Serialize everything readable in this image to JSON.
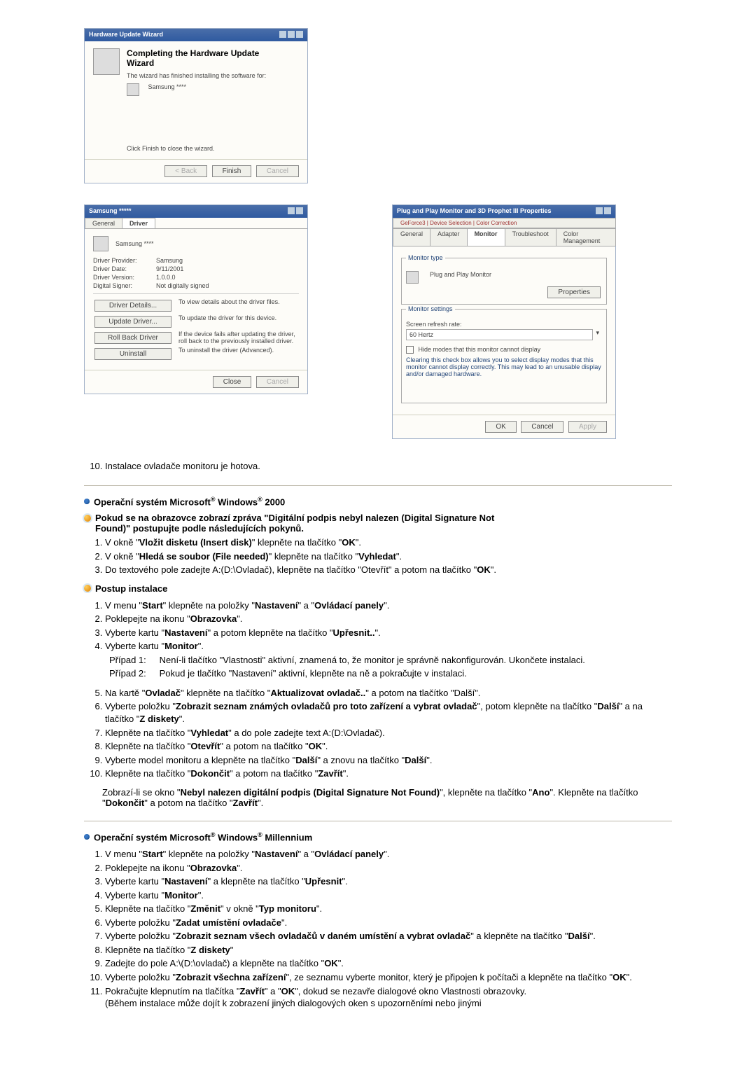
{
  "wizard": {
    "title": "Hardware Update Wizard",
    "heading": "Completing the Hardware Update Wizard",
    "line1": "The wizard has finished installing the software for:",
    "device": "Samsung ****",
    "line2": "Click Finish to close the wizard.",
    "back": "< Back",
    "finish": "Finish",
    "cancel": "Cancel"
  },
  "props1": {
    "title": "Samsung *****",
    "tab_general": "General",
    "tab_driver": "Driver",
    "device": "Samsung ****",
    "k_provider": "Driver Provider:",
    "v_provider": "Samsung",
    "k_date": "Driver Date:",
    "v_date": "9/11/2001",
    "k_version": "Driver Version:",
    "v_version": "1.0.0.0",
    "k_signer": "Digital Signer:",
    "v_signer": "Not digitally signed",
    "btn_details": "Driver Details...",
    "txt_details": "To view details about the driver files.",
    "btn_update": "Update Driver...",
    "txt_update": "To update the driver for this device.",
    "btn_roll": "Roll Back Driver",
    "txt_roll": "If the device fails after updating the driver, roll back to the previously installed driver.",
    "btn_uninst": "Uninstall",
    "txt_uninst": "To uninstall the driver (Advanced).",
    "close": "Close",
    "cancel": "Cancel"
  },
  "props2": {
    "title": "Plug and Play Monitor and 3D Prophet III Properties",
    "tabs_top": "GeForce3   |   Device Selection   |   Color Correction",
    "tabs_bot_general": "General",
    "tabs_bot_adapter": "Adapter",
    "tabs_bot_monitor": "Monitor",
    "tabs_bot_trouble": "Troubleshoot",
    "tabs_bot_colormgmt": "Color Management",
    "grp_type": "Monitor type",
    "type_val": "Plug and Play Monitor",
    "btn_props": "Properties",
    "grp_settings": "Monitor settings",
    "lbl_refresh": "Screen refresh rate:",
    "val_refresh": "60 Hertz",
    "cb_hide": "Hide modes that this monitor cannot display",
    "hide_txt": "Clearing this check box allows you to select display modes that this monitor cannot display correctly. This may lead to an unusable display and/or damaged hardware.",
    "ok": "OK",
    "cancel": "Cancel",
    "apply": "Apply"
  },
  "step10": "Instalace ovladače monitoru je hotova.",
  "w2000_heading_a": "Operační systém Microsoft",
  "w2000_heading_b": " Windows",
  "w2000_heading_c": " 2000",
  "w2000_note_line1": "Pokud se na obrazovce zobrazí zpráva \"Digitální podpis nebyl nalezen (Digital Signature Not",
  "w2000_note_line2": "Found)\" postupujte podle následujících pokynů.",
  "w2000_note_items": {
    "1a": "V okně \"",
    "1b": "Vložit disketu (Insert disk)",
    "1c": "\" klepněte na tlačítko \"",
    "1d": "OK",
    "1e": "\".",
    "2a": "V okně \"",
    "2b": "Hledá se soubor (File needed)",
    "2c": "\" klepněte na tlačítko \"",
    "2d": "Vyhledat",
    "2e": "\".",
    "3a": "Do textového pole zadejte A:(D:\\Ovladač), klepněte na tlačítko \"Otevřít\" a potom na tlačítko \"",
    "3b": "OK",
    "3c": "\"."
  },
  "install_heading": "Postup instalace",
  "install": {
    "1a": "V menu \"",
    "1b": "Start",
    "1c": "\" klepněte na položky \"",
    "1d": "Nastavení",
    "1e": "\" a \"",
    "1f": "Ovládací panely",
    "1g": "\".",
    "2a": "Poklepejte na ikonu \"",
    "2b": "Obrazovka",
    "2c": "\".",
    "3a": "Vyberte kartu \"",
    "3b": "Nastavení",
    "3c": "\" a potom klepněte na tlačítko \"",
    "3d": "Upřesnit..",
    "3e": "\".",
    "4a": "Vyberte kartu \"",
    "4b": "Monitor",
    "4c": "\".",
    "case1_lbl": "Případ 1:",
    "case1_txt": " Není-li tlačítko \"Vlastnosti\" aktivní, znamená to, že monitor je správně nakonfigurován. Ukončete instalaci.",
    "case2_lbl": "Případ 2:",
    "case2_txt": " Pokud je tlačítko \"Nastavení\" aktivní, klepněte na ně a pokračujte v instalaci.",
    "5a": "Na kartě \"",
    "5b": "Ovladač",
    "5c": "\" klepněte na tlačítko \"",
    "5d": "Aktualizovat ovladač..",
    "5e": "\" a potom na tlačítko \"Další\".",
    "6a": "Vyberte položku \"",
    "6b": "Zobrazit seznam známých ovladačů pro toto zařízení a vybrat ovladač",
    "6c": "\", potom klepněte na tlačítko \"",
    "6d": "Další",
    "6e": "\" a na tlačítko \"",
    "6f": "Z diskety",
    "6g": "\".",
    "7a": "Klepněte na tlačítko \"",
    "7b": "Vyhledat",
    "7c": "\" a do pole zadejte text A:(D:\\Ovladač).",
    "8a": "Klepněte na tlačítko \"",
    "8b": "Otevřít",
    "8c": "\" a potom na tlačítko \"",
    "8d": "OK",
    "8e": "\".",
    "9a": "Vyberte model monitoru a klepněte na tlačítko \"",
    "9b": "Další",
    "9c": "\" a znovu na tlačítko \"",
    "9d": "Další",
    "9e": "\".",
    "10a": "Klepněte na tlačítko \"",
    "10b": "Dokončit",
    "10c": "\" a potom na tlačítko \"",
    "10d": "Zavřít",
    "10e": "\".",
    "sig1": "Zobrazí-li se okno \"",
    "sig1b": "Nebyl nalezen digitální podpis (Digital Signature Not Found)",
    "sig1c": "\", klepněte na tlačítko \"",
    "sig1d": "Ano",
    "sig1e": "\". Klepněte na tlačítko \"",
    "sig1f": "Dokončit",
    "sig1g": "\" a potom na tlačítko \"",
    "sig1h": "Zavřít",
    "sig1i": "\"."
  },
  "wme_heading_a": "Operační systém Microsoft",
  "wme_heading_b": " Windows",
  "wme_heading_c": " Millennium",
  "wme": {
    "1a": "V menu \"",
    "1b": "Start",
    "1c": "\" klepněte na položky \"",
    "1d": "Nastavení",
    "1e": "\" a \"",
    "1f": "Ovládací panely",
    "1g": "\".",
    "2a": "Poklepejte na ikonu \"",
    "2b": "Obrazovka",
    "2c": "\".",
    "3a": "Vyberte kartu \"",
    "3b": "Nastavení",
    "3c": "\" a klepněte na tlačítko \"",
    "3d": "Upřesnit",
    "3e": "\".",
    "4a": "Vyberte kartu \"",
    "4b": "Monitor",
    "4c": "\".",
    "5a": "Klepněte na tlačítko \"",
    "5b": "Změnit",
    "5c": "\" v okně \"",
    "5d": "Typ monitoru",
    "5e": "\".",
    "6a": "Vyberte položku \"",
    "6b": "Zadat umístění ovladače",
    "6c": "\".",
    "7a": "Vyberte položku \"",
    "7b": "Zobrazit seznam všech ovladačů v daném umístění a vybrat ovladač",
    "7c": "\" a klepněte na tlačítko \"",
    "7d": "Další",
    "7e": "\".",
    "8a": "Klepněte na tlačítko \"",
    "8b": "Z diskety",
    "8c": "\"",
    "9a": "Zadejte do pole A:\\(D:\\ovladač) a klepněte na tlačítko \"",
    "9b": "OK",
    "9c": "\".",
    "10a": "Vyberte položku \"",
    "10b": "Zobrazit všechna zařízení",
    "10c": "\", ze seznamu vyberte monitor, který je připojen k počítači a klepněte na tlačítko \"",
    "10d": "OK",
    "10e": "\".",
    "11a": "Pokračujte klepnutím na tlačítka \"",
    "11b": "Zavřít",
    "11c": "\" a \"",
    "11d": "OK",
    "11e": "\", dokud se nezavře dialogové okno Vlastnosti obrazovky.",
    "paren": "(Během instalace může dojít k zobrazení jiných dialogových oken s upozorněními nebo jinými"
  }
}
